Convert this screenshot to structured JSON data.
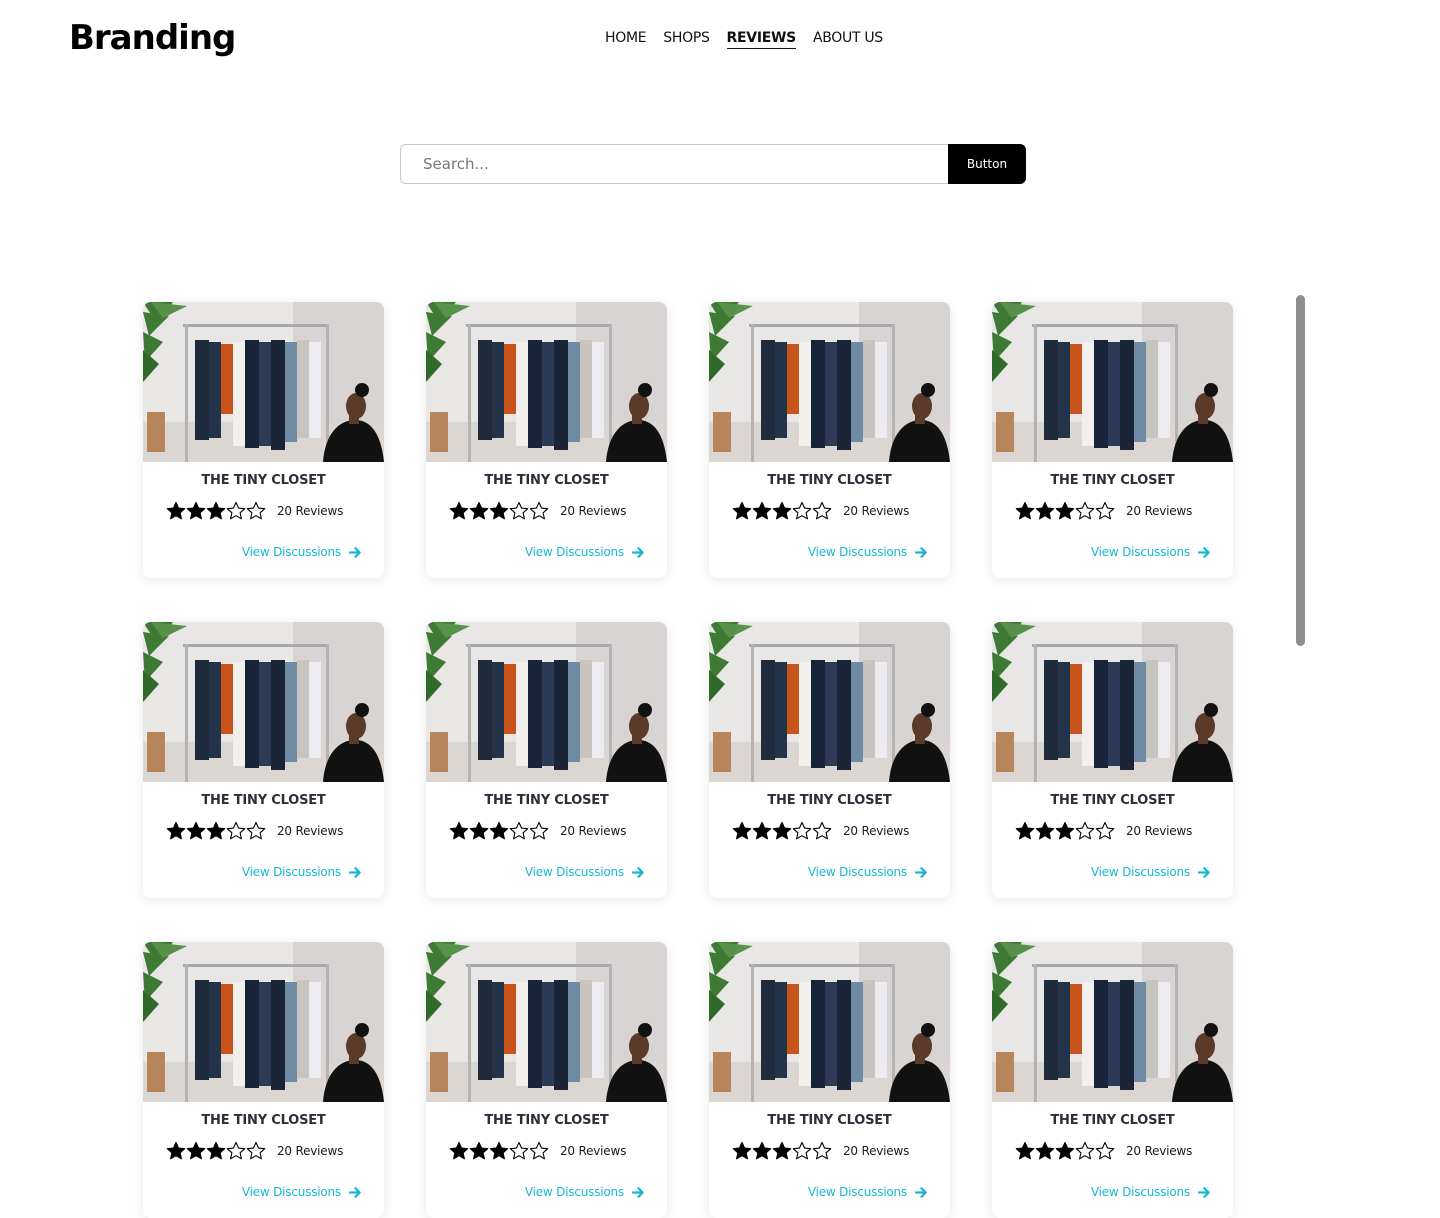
{
  "header": {
    "brand": "Branding",
    "nav": [
      {
        "label": "HOME",
        "active": false
      },
      {
        "label": "SHOPS",
        "active": false
      },
      {
        "label": "REVIEWS",
        "active": true
      },
      {
        "label": "ABOUT US",
        "active": false
      }
    ]
  },
  "search": {
    "placeholder": "Search...",
    "value": "",
    "button_label": "Button"
  },
  "colors": {
    "link": "#17b7d1",
    "button_bg": "#000000",
    "title": "#2a2f3a"
  },
  "cards": [
    {
      "title": "THE TINY CLOSET",
      "rating": 3,
      "max_rating": 5,
      "reviews": "20 Reviews",
      "link": "View Discussions"
    },
    {
      "title": "THE TINY CLOSET",
      "rating": 3,
      "max_rating": 5,
      "reviews": "20 Reviews",
      "link": "View Discussions"
    },
    {
      "title": "THE TINY CLOSET",
      "rating": 3,
      "max_rating": 5,
      "reviews": "20 Reviews",
      "link": "View Discussions"
    },
    {
      "title": "THE TINY CLOSET",
      "rating": 3,
      "max_rating": 5,
      "reviews": "20 Reviews",
      "link": "View Discussions"
    },
    {
      "title": "THE TINY CLOSET",
      "rating": 3,
      "max_rating": 5,
      "reviews": "20 Reviews",
      "link": "View Discussions"
    },
    {
      "title": "THE TINY CLOSET",
      "rating": 3,
      "max_rating": 5,
      "reviews": "20 Reviews",
      "link": "View Discussions"
    },
    {
      "title": "THE TINY CLOSET",
      "rating": 3,
      "max_rating": 5,
      "reviews": "20 Reviews",
      "link": "View Discussions"
    },
    {
      "title": "THE TINY CLOSET",
      "rating": 3,
      "max_rating": 5,
      "reviews": "20 Reviews",
      "link": "View Discussions"
    },
    {
      "title": "THE TINY CLOSET",
      "rating": 3,
      "max_rating": 5,
      "reviews": "20 Reviews",
      "link": "View Discussions"
    },
    {
      "title": "THE TINY CLOSET",
      "rating": 3,
      "max_rating": 5,
      "reviews": "20 Reviews",
      "link": "View Discussions"
    },
    {
      "title": "THE TINY CLOSET",
      "rating": 3,
      "max_rating": 5,
      "reviews": "20 Reviews",
      "link": "View Discussions"
    },
    {
      "title": "THE TINY CLOSET",
      "rating": 3,
      "max_rating": 5,
      "reviews": "20 Reviews",
      "link": "View Discussions"
    }
  ],
  "icons": {
    "star_filled": "star-filled-icon",
    "star_empty": "star-empty-icon",
    "arrow": "arrow-right-icon",
    "card_image": "clothing-rack-photo"
  }
}
